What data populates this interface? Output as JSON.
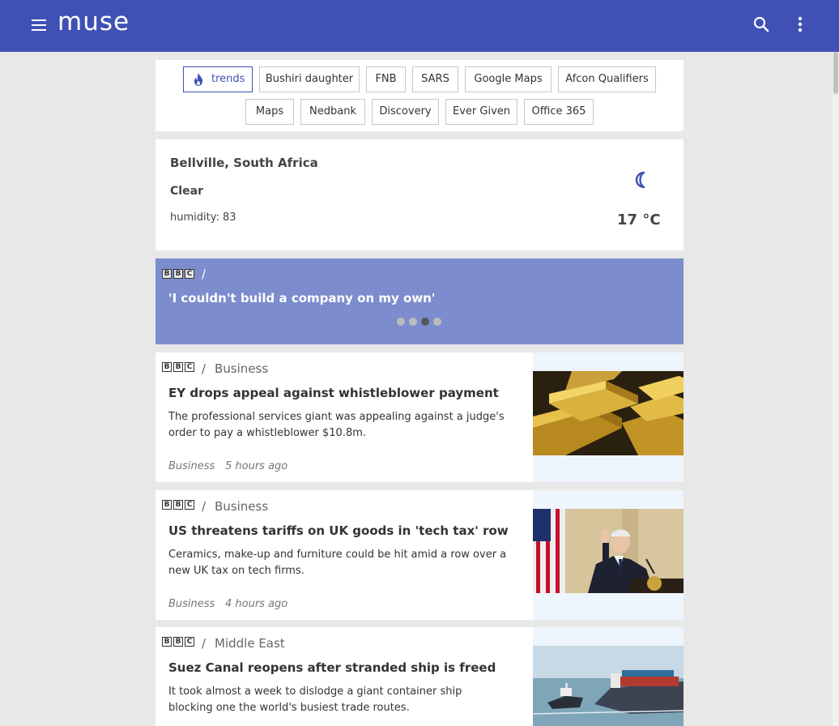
{
  "app": {
    "name": "muse"
  },
  "colors": {
    "appbar": "#3f51b5",
    "carousel": "#7d8ccd",
    "accent": "#3f51b5"
  },
  "header": {
    "menu_icon": "hamburger-menu-icon",
    "search_icon": "search-icon",
    "more_icon": "more-vert-icon"
  },
  "trends": {
    "label": "trends",
    "icon": "flame-icon",
    "chips": [
      "Bushiri daughter",
      "FNB",
      "SARS",
      "Google Maps",
      "Afcon Qualifiers",
      "Maps",
      "Nedbank",
      "Discovery",
      "Ever Given",
      "Office 365"
    ]
  },
  "weather": {
    "location": "Bellville, South Africa",
    "condition": "Clear",
    "humidity": "humidity: 83",
    "temperature": "17 °C",
    "icon": "crescent-moon-icon"
  },
  "carousel": {
    "source_logo": "BBC",
    "separator": "/",
    "title": "'I couldn't build a company on my own'",
    "slides_total": 4,
    "active_slide": 3
  },
  "articles": [
    {
      "source_logo": "BBC",
      "separator": "/",
      "category": "Business",
      "title": "EY drops appeal against whistleblower payment",
      "description": "The professional services giant was appealing against a judge's order to pay a whistleblower $10.8m.",
      "meta_category": "Business",
      "time": "5 hours ago",
      "image": "gold-bars-image"
    },
    {
      "source_logo": "BBC",
      "separator": "/",
      "category": "Business",
      "title": "US threatens tariffs on UK goods in 'tech tax' row",
      "description": "Ceramics, make-up and furniture could be hit amid a row over a new UK tax on tech firms.",
      "meta_category": "Business",
      "time": "4 hours ago",
      "image": "president-at-podium-image"
    },
    {
      "source_logo": "BBC",
      "separator": "/",
      "category": "Middle East",
      "title": "Suez Canal reopens after stranded ship is freed",
      "description": "It took almost a week to dislodge a giant container ship blocking one the world's busiest trade routes.",
      "meta_category": "",
      "time": "",
      "image": "container-ship-image"
    }
  ]
}
